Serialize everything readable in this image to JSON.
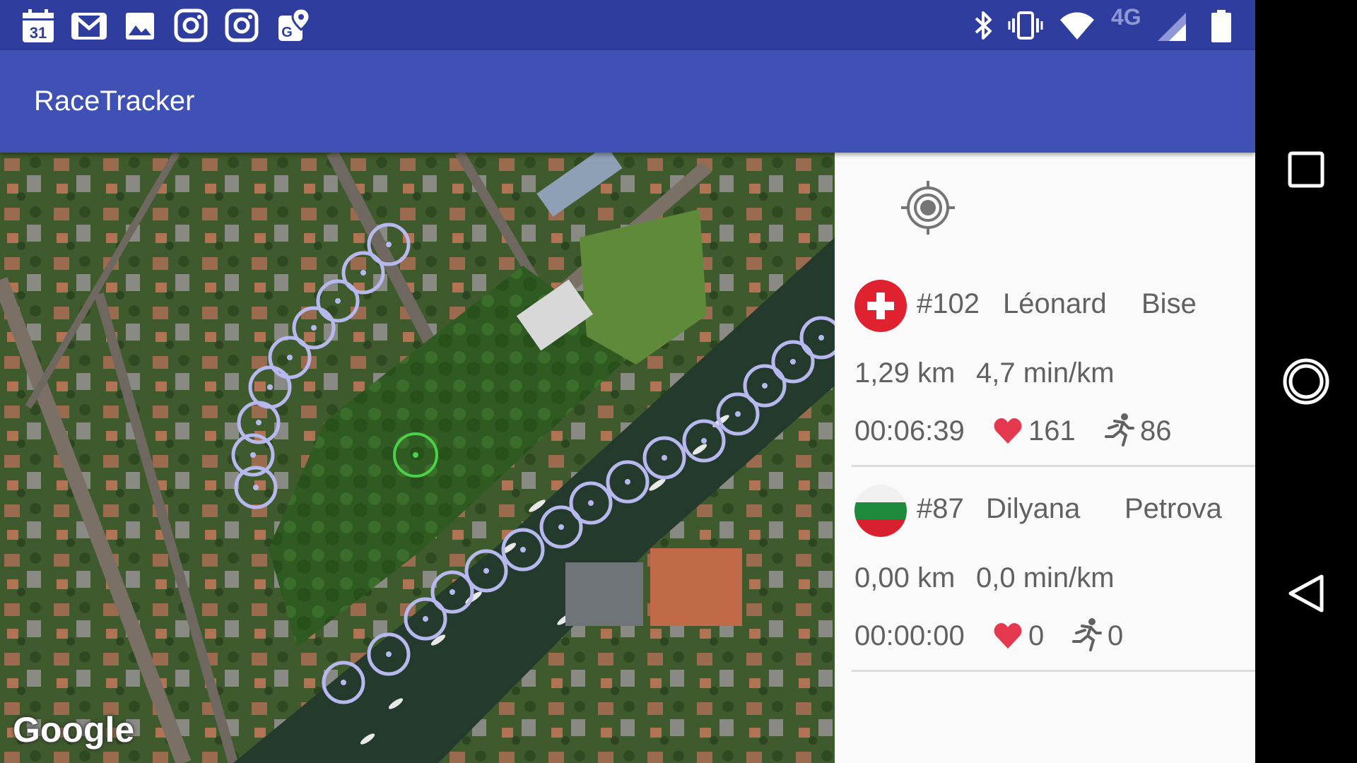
{
  "app": {
    "title": "RaceTracker"
  },
  "statusbar": {
    "left_icons": [
      "calendar-icon",
      "gmail-icon",
      "gallery-icon",
      "instagram-icon",
      "instagram-icon",
      "maps-icon"
    ],
    "calendar_day": "31",
    "network": "4G",
    "right_icons": [
      "bluetooth-icon",
      "vibrate-icon",
      "wifi-icon",
      "signal-icon",
      "battery-icon"
    ]
  },
  "map": {
    "attribution": "Google"
  },
  "runners": [
    {
      "flag": "switzerland-flag-icon",
      "bib": "#102",
      "first_name": "Léonard",
      "last_name": "Bise",
      "distance": "1,29 km",
      "pace": "4,7 min/km",
      "time": "00:06:39",
      "heart_rate": "161",
      "cadence": "86"
    },
    {
      "flag": "bulgaria-flag-icon",
      "bib": "#87",
      "first_name": "Dilyana",
      "last_name": "Petrova",
      "distance": "0,00 km",
      "pace": "0,0 min/km",
      "time": "00:00:00",
      "heart_rate": "0",
      "cadence": "0"
    }
  ],
  "colors": {
    "statusbar": "#2f3e9e",
    "appbar": "#3f51b5",
    "heart": "#e53950",
    "track_circle": "#b7b8ee",
    "current_position": "#4ad04a"
  },
  "navbar": [
    "recents-button",
    "home-button",
    "back-button"
  ]
}
